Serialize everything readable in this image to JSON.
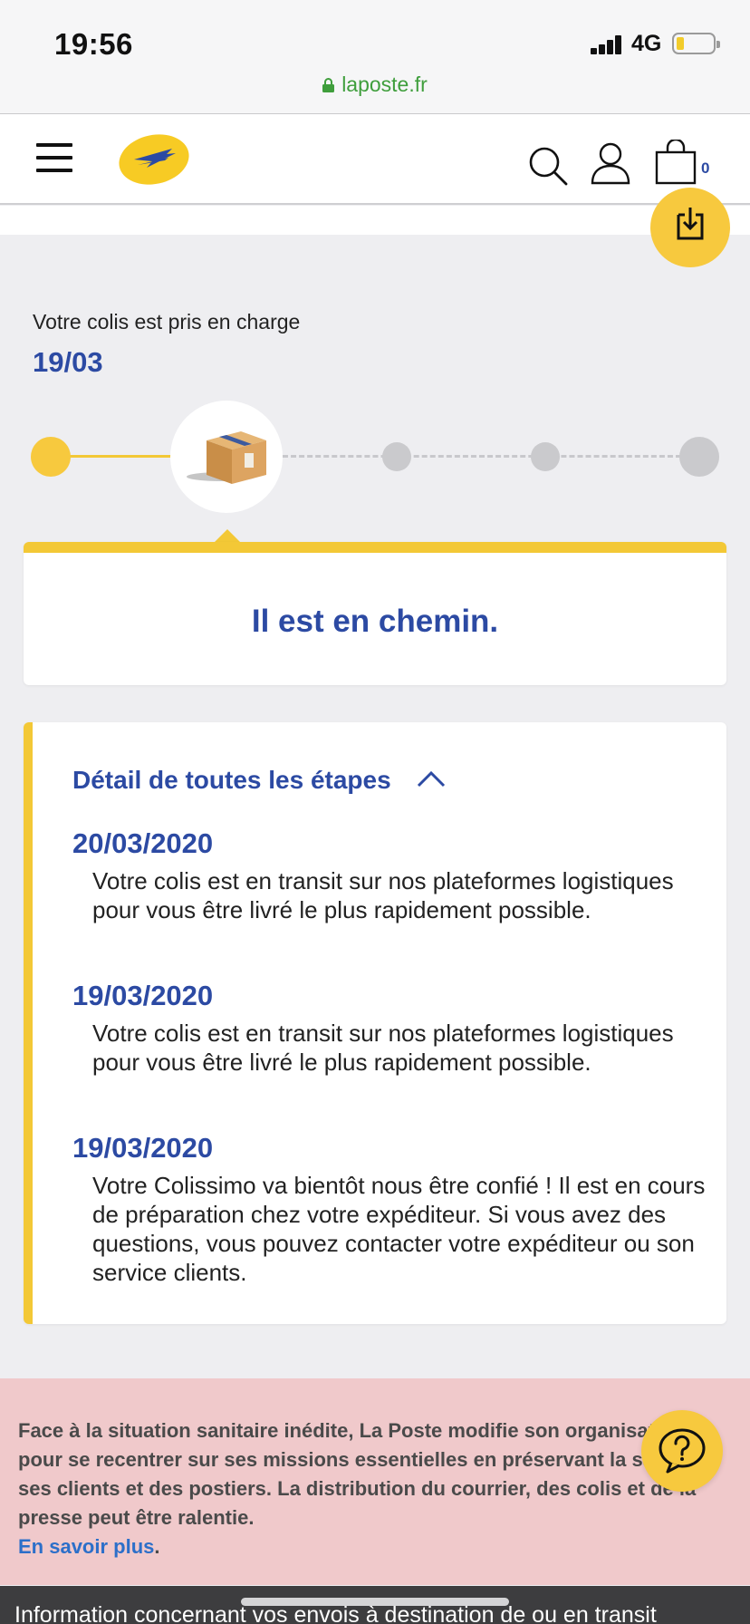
{
  "status_bar": {
    "time": "19:56",
    "network": "4G",
    "url": "laposte.fr"
  },
  "header": {
    "cart_count": "0"
  },
  "tracking": {
    "status_line": "Votre colis est pris en charge",
    "date": "19/03",
    "step_message": "Il est en chemin."
  },
  "details": {
    "title": "Détail de toutes les étapes",
    "events": [
      {
        "date": "20/03/2020",
        "text": "Votre colis est en transit sur nos plateformes logistiques pour vous être livré le plus rapidement possible."
      },
      {
        "date": "19/03/2020",
        "text": "Votre colis est en transit sur nos plateformes logistiques pour vous être livré le plus rapidement possible."
      },
      {
        "date": "19/03/2020",
        "text": "Votre Colissimo va bientôt nous être confié ! Il est en cours de préparation chez votre expéditeur. Si vous avez des questions, vous pouvez contacter votre expéditeur ou son service clients."
      }
    ]
  },
  "notice": {
    "text": "Face à la situation sanitaire inédite, La Poste modifie son organisation pour se recentrer sur ses missions essentielles en préservant la santé de ses clients et des postiers. La distribution du courrier, des colis et de la presse peut être ralentie.",
    "link": "En savoir plus",
    "link_suffix": "."
  },
  "bottom_bar": {
    "text": "Information concernant vos envois à destination de ou en transit"
  },
  "colors": {
    "brand_yellow": "#f3c836",
    "brand_blue": "#2c4aa3",
    "notice_bg": "#f0c9cb",
    "url_green": "#3f9e3c"
  }
}
